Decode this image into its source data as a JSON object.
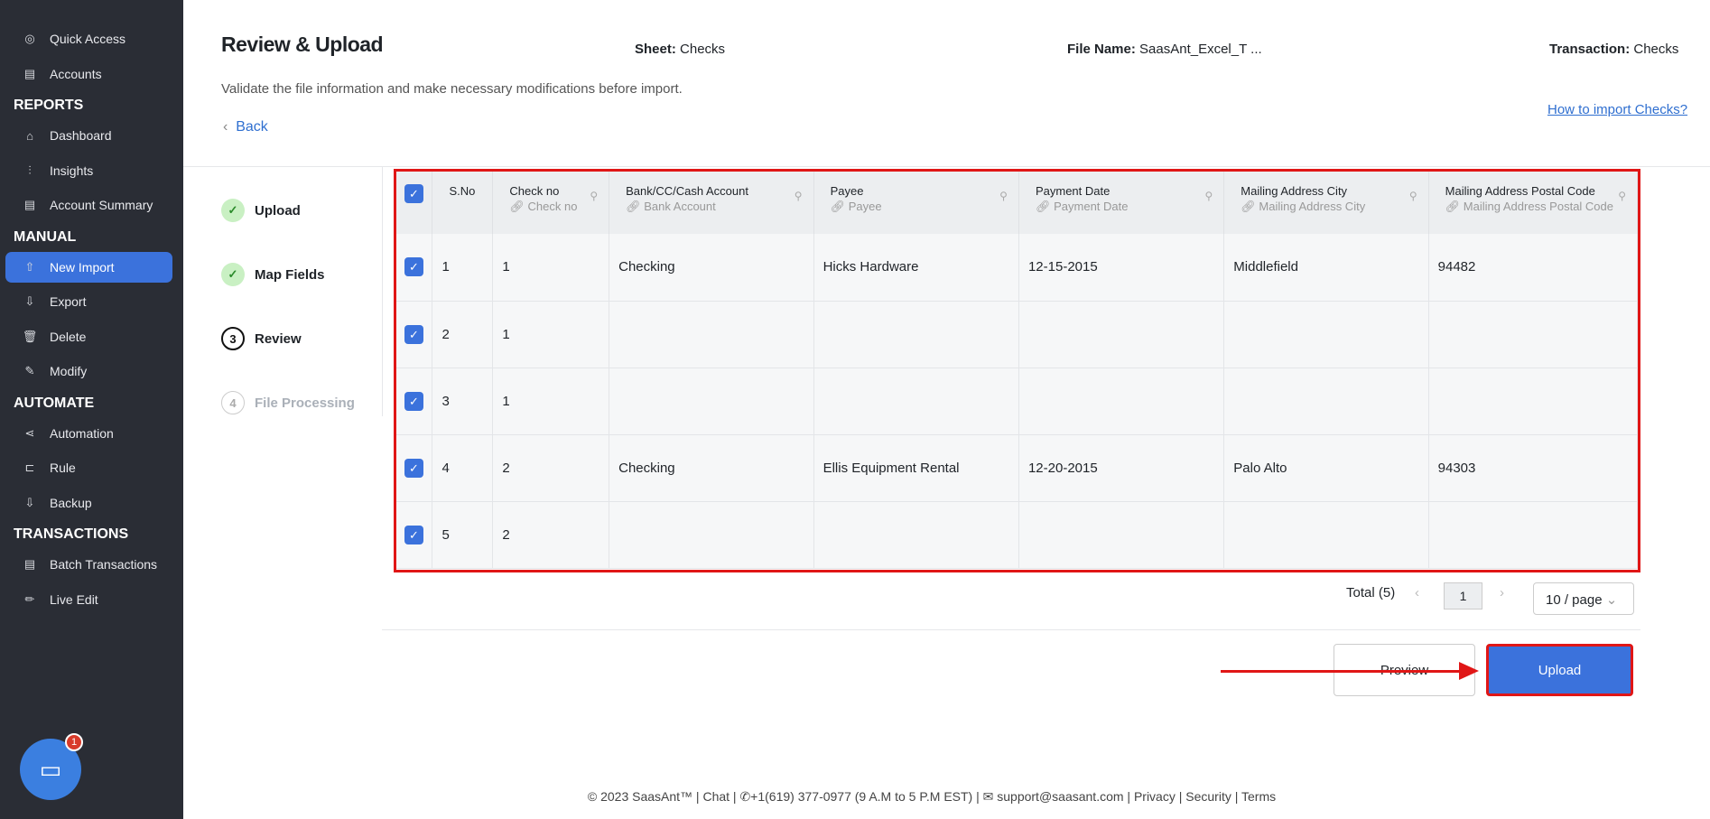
{
  "sidebar": {
    "items": [
      {
        "label": "Quick Access",
        "icon": "target-icon"
      },
      {
        "label": "Accounts",
        "icon": "clipboard-icon"
      },
      {
        "section": "REPORTS"
      },
      {
        "label": "Dashboard",
        "icon": "home-icon"
      },
      {
        "label": "Insights",
        "icon": "sliders-icon"
      },
      {
        "label": "Account Summary",
        "icon": "clipboard-icon"
      },
      {
        "section": "MANUAL"
      },
      {
        "label": "New Import",
        "icon": "cloud-upload-icon",
        "active": true
      },
      {
        "label": "Export",
        "icon": "cloud-download-icon"
      },
      {
        "label": "Delete",
        "icon": "trash-icon"
      },
      {
        "label": "Modify",
        "icon": "edit-file-icon"
      },
      {
        "section": "AUTOMATE"
      },
      {
        "label": "Automation",
        "icon": "share-icon"
      },
      {
        "label": "Rule",
        "icon": "megaphone-icon"
      },
      {
        "label": "Backup",
        "icon": "cloud-download-icon"
      },
      {
        "section": "TRANSACTIONS"
      },
      {
        "label": "Batch Transactions",
        "icon": "document-icon"
      },
      {
        "label": "Live Edit",
        "icon": "pencil-icon"
      }
    ],
    "chat_badge": "1"
  },
  "header": {
    "title": "Review & Upload",
    "sheet_label": "Sheet:",
    "sheet": "Checks",
    "file_label": "File Name:",
    "file": "SaasAnt_Excel_T ...",
    "txn_label": "Transaction:",
    "txn": "Checks",
    "subtitle": "Validate the file information and make necessary modifications before import.",
    "back": "Back",
    "help": "How to import Checks?"
  },
  "steps": [
    {
      "n": "✓",
      "label": "Upload",
      "state": "done"
    },
    {
      "n": "✓",
      "label": "Map Fields",
      "state": "done"
    },
    {
      "n": "3",
      "label": "Review",
      "state": "cur"
    },
    {
      "n": "4",
      "label": "File Processing",
      "state": "pend"
    }
  ],
  "table": {
    "columns": [
      {
        "h": "S.No",
        "s": ""
      },
      {
        "h": "Check no",
        "s": "Check no"
      },
      {
        "h": "Bank/CC/Cash Account",
        "s": "Bank Account"
      },
      {
        "h": "Payee",
        "s": "Payee"
      },
      {
        "h": "Payment Date",
        "s": "Payment Date"
      },
      {
        "h": "Mailing Address City",
        "s": "Mailing Address City"
      },
      {
        "h": "Mailing Address Postal Code",
        "s": "Mailing Address Postal Code"
      }
    ],
    "rows": [
      [
        "1",
        "1",
        "Checking",
        "Hicks Hardware",
        "12-15-2015",
        "Middlefield",
        "94482"
      ],
      [
        "2",
        "1",
        "",
        "",
        "",
        "",
        ""
      ],
      [
        "3",
        "1",
        "",
        "",
        "",
        "",
        ""
      ],
      [
        "4",
        "2",
        "Checking",
        "Ellis Equipment Rental",
        "12-20-2015",
        "Palo Alto",
        "94303"
      ],
      [
        "5",
        "2",
        "",
        "",
        "",
        "",
        ""
      ]
    ]
  },
  "pagination": {
    "total": "Total (5)",
    "page": "1",
    "per_page": "10 / page"
  },
  "actions": {
    "preview": "Preview",
    "upload": "Upload"
  },
  "footer": "© 2023 SaasAnt™  | Chat  |  ✆+1(619) 377-0977 (9 A.M to 5 P.M EST)  |  ✉ support@saasant.com  | Privacy  | Security  | Terms"
}
